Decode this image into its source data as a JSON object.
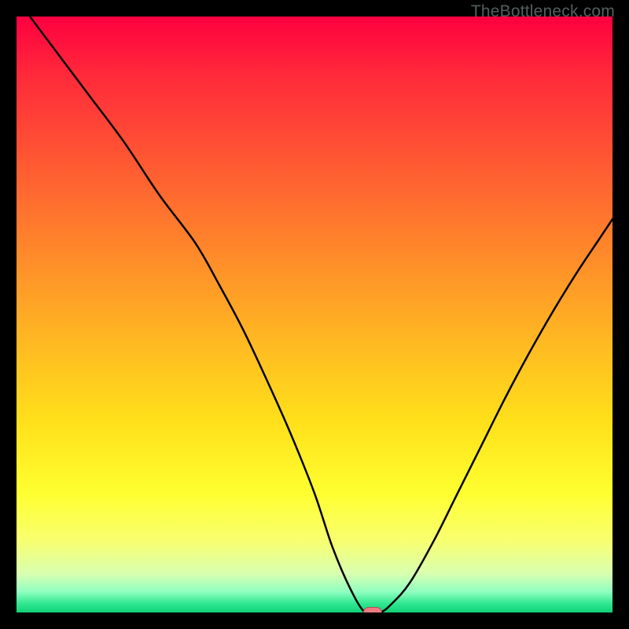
{
  "watermark": "TheBottleneck.com",
  "chart_data": {
    "type": "line",
    "title": "",
    "xlabel": "",
    "ylabel": "",
    "xlim": [
      0,
      100
    ],
    "ylim": [
      0,
      100
    ],
    "x": [
      0,
      6,
      12,
      18,
      24,
      30,
      34,
      38,
      42,
      46,
      50,
      53,
      56,
      58.5,
      61,
      63,
      66,
      70,
      74,
      78,
      82,
      86,
      90,
      94,
      98,
      100
    ],
    "values": [
      103,
      95,
      87,
      79,
      70,
      62,
      55,
      47.5,
      39,
      30,
      20,
      11,
      4,
      0,
      0,
      1.5,
      5,
      12,
      20,
      28,
      36,
      43.5,
      50.5,
      57,
      63,
      66
    ],
    "marker_x": [
      58.5,
      61
    ],
    "gradient_stops": [
      {
        "offset": 0.0,
        "color": "#ff0040"
      },
      {
        "offset": 0.1,
        "color": "#ff2a3a"
      },
      {
        "offset": 0.25,
        "color": "#ff5a32"
      },
      {
        "offset": 0.4,
        "color": "#ff8a2a"
      },
      {
        "offset": 0.55,
        "color": "#ffba22"
      },
      {
        "offset": 0.68,
        "color": "#ffe01a"
      },
      {
        "offset": 0.8,
        "color": "#ffff30"
      },
      {
        "offset": 0.88,
        "color": "#f8ff70"
      },
      {
        "offset": 0.935,
        "color": "#d8ffb0"
      },
      {
        "offset": 0.965,
        "color": "#90ffc0"
      },
      {
        "offset": 0.985,
        "color": "#30e890"
      },
      {
        "offset": 1.0,
        "color": "#10d078"
      }
    ],
    "curve_color": "#000000",
    "marker_fill": "#ed7b82",
    "marker_stroke": "#b94a55"
  }
}
